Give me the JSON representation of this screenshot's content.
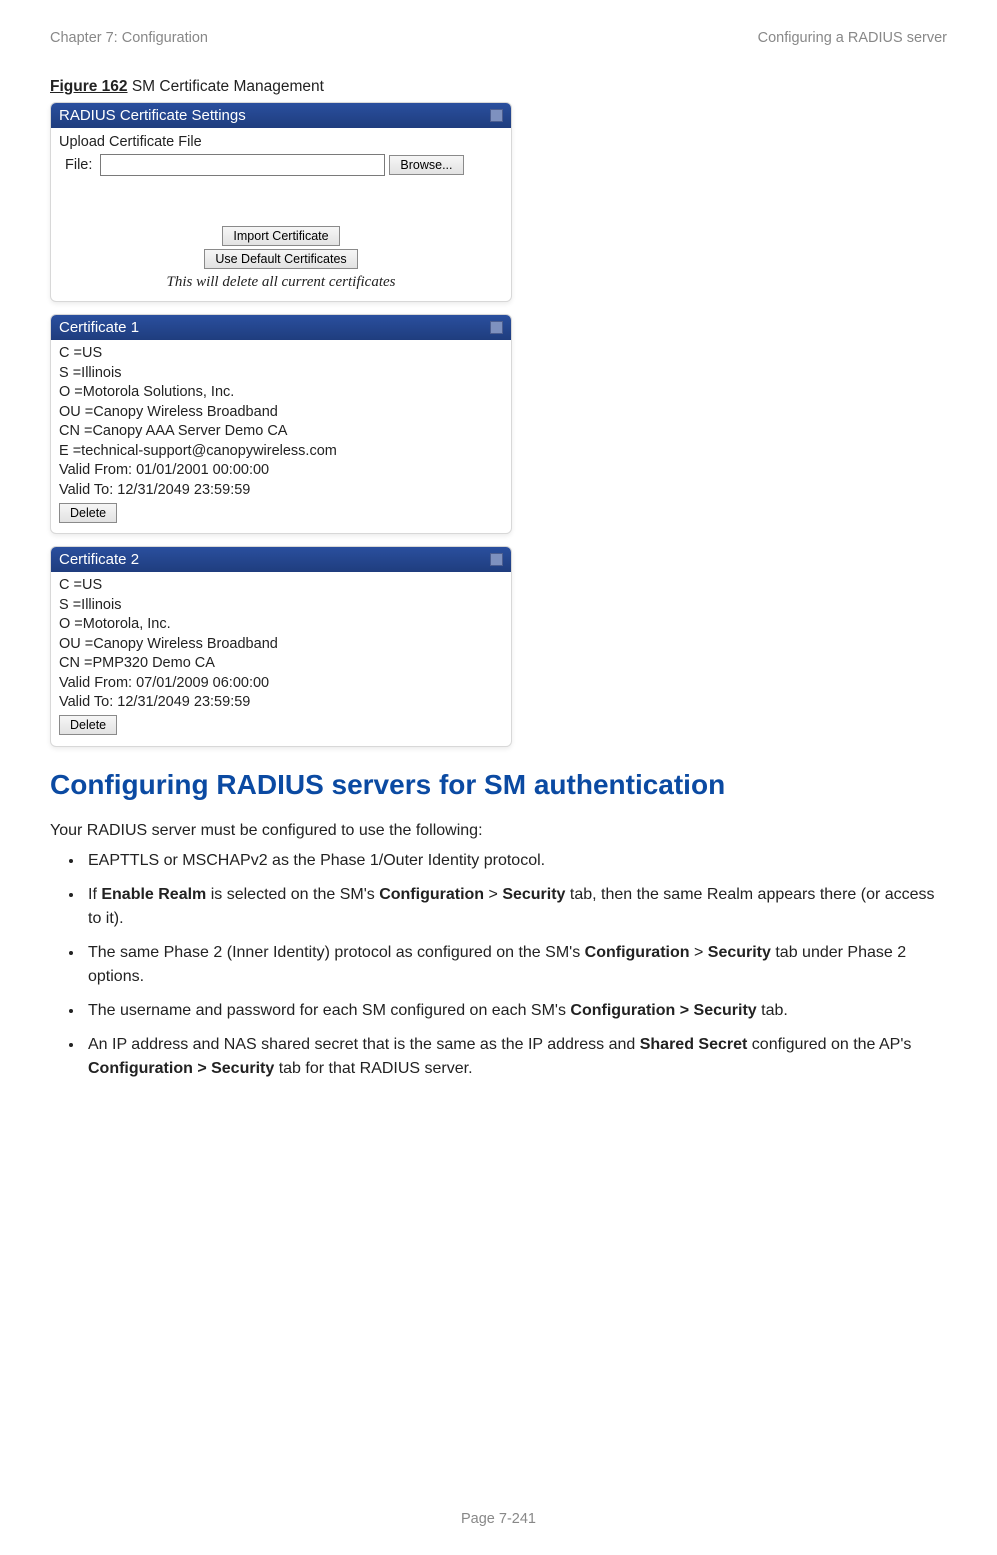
{
  "header": {
    "left": "Chapter 7:  Configuration",
    "right": "Configuring a RADIUS server"
  },
  "figure": {
    "number": "Figure 162",
    "caption": " SM Certificate Management"
  },
  "settings_panel": {
    "title": "RADIUS Certificate Settings",
    "upload_label": "Upload Certificate File",
    "file_label": "File:",
    "browse_btn": "Browse...",
    "import_btn": "Import Certificate",
    "default_btn": "Use Default Certificates",
    "note": "This will delete all current certificates"
  },
  "cert1": {
    "title": "Certificate 1",
    "c": "C =US",
    "s": "S =Illinois",
    "o": "O =Motorola Solutions, Inc.",
    "ou": "OU =Canopy Wireless Broadband",
    "cn": "CN =Canopy AAA Server Demo CA",
    "e": "E =technical-support@canopywireless.com",
    "valid_from": "Valid From: 01/01/2001 00:00:00",
    "valid_to": "Valid To: 12/31/2049 23:59:59",
    "delete_btn": "Delete"
  },
  "cert2": {
    "title": "Certificate 2",
    "c": "C =US",
    "s": "S =Illinois",
    "o": "O =Motorola, Inc.",
    "ou": "OU =Canopy Wireless Broadband",
    "cn": "CN =PMP320 Demo CA",
    "valid_from": "Valid From: 07/01/2009 06:00:00",
    "valid_to": "Valid To: 12/31/2049 23:59:59",
    "delete_btn": "Delete"
  },
  "section": {
    "title": "Configuring RADIUS servers for SM authentication",
    "intro": "Your RADIUS server must be configured to use the following:",
    "b1": "EAPTTLS or MSCHAPv2 as the Phase 1/Outer Identity protocol.",
    "b2a": "If ",
    "b2b": "Enable Realm",
    "b2c": " is selected on the SM's ",
    "b2d": "Configuration",
    "b2e": " > ",
    "b2f": "Security",
    "b2g": " tab, then the same Realm appears there (or access to it).",
    "b3a": "The same Phase 2 (Inner Identity) protocol as configured on the SM's ",
    "b3b": "Configuration",
    "b3c": " > ",
    "b3d": "Security",
    "b3e": " tab under Phase 2 options.",
    "b4a": "The username and password for each SM configured on each SM's ",
    "b4b": "Configuration > Security",
    "b4c": " tab.",
    "b5a": "An IP address and NAS shared secret that is the same as the IP address and ",
    "b5b": "Shared Secret",
    "b5c": " configured on the AP's ",
    "b5d": "Configuration > Security",
    "b5e": " tab for that RADIUS server."
  },
  "footer": {
    "page": "Page 7-241"
  }
}
